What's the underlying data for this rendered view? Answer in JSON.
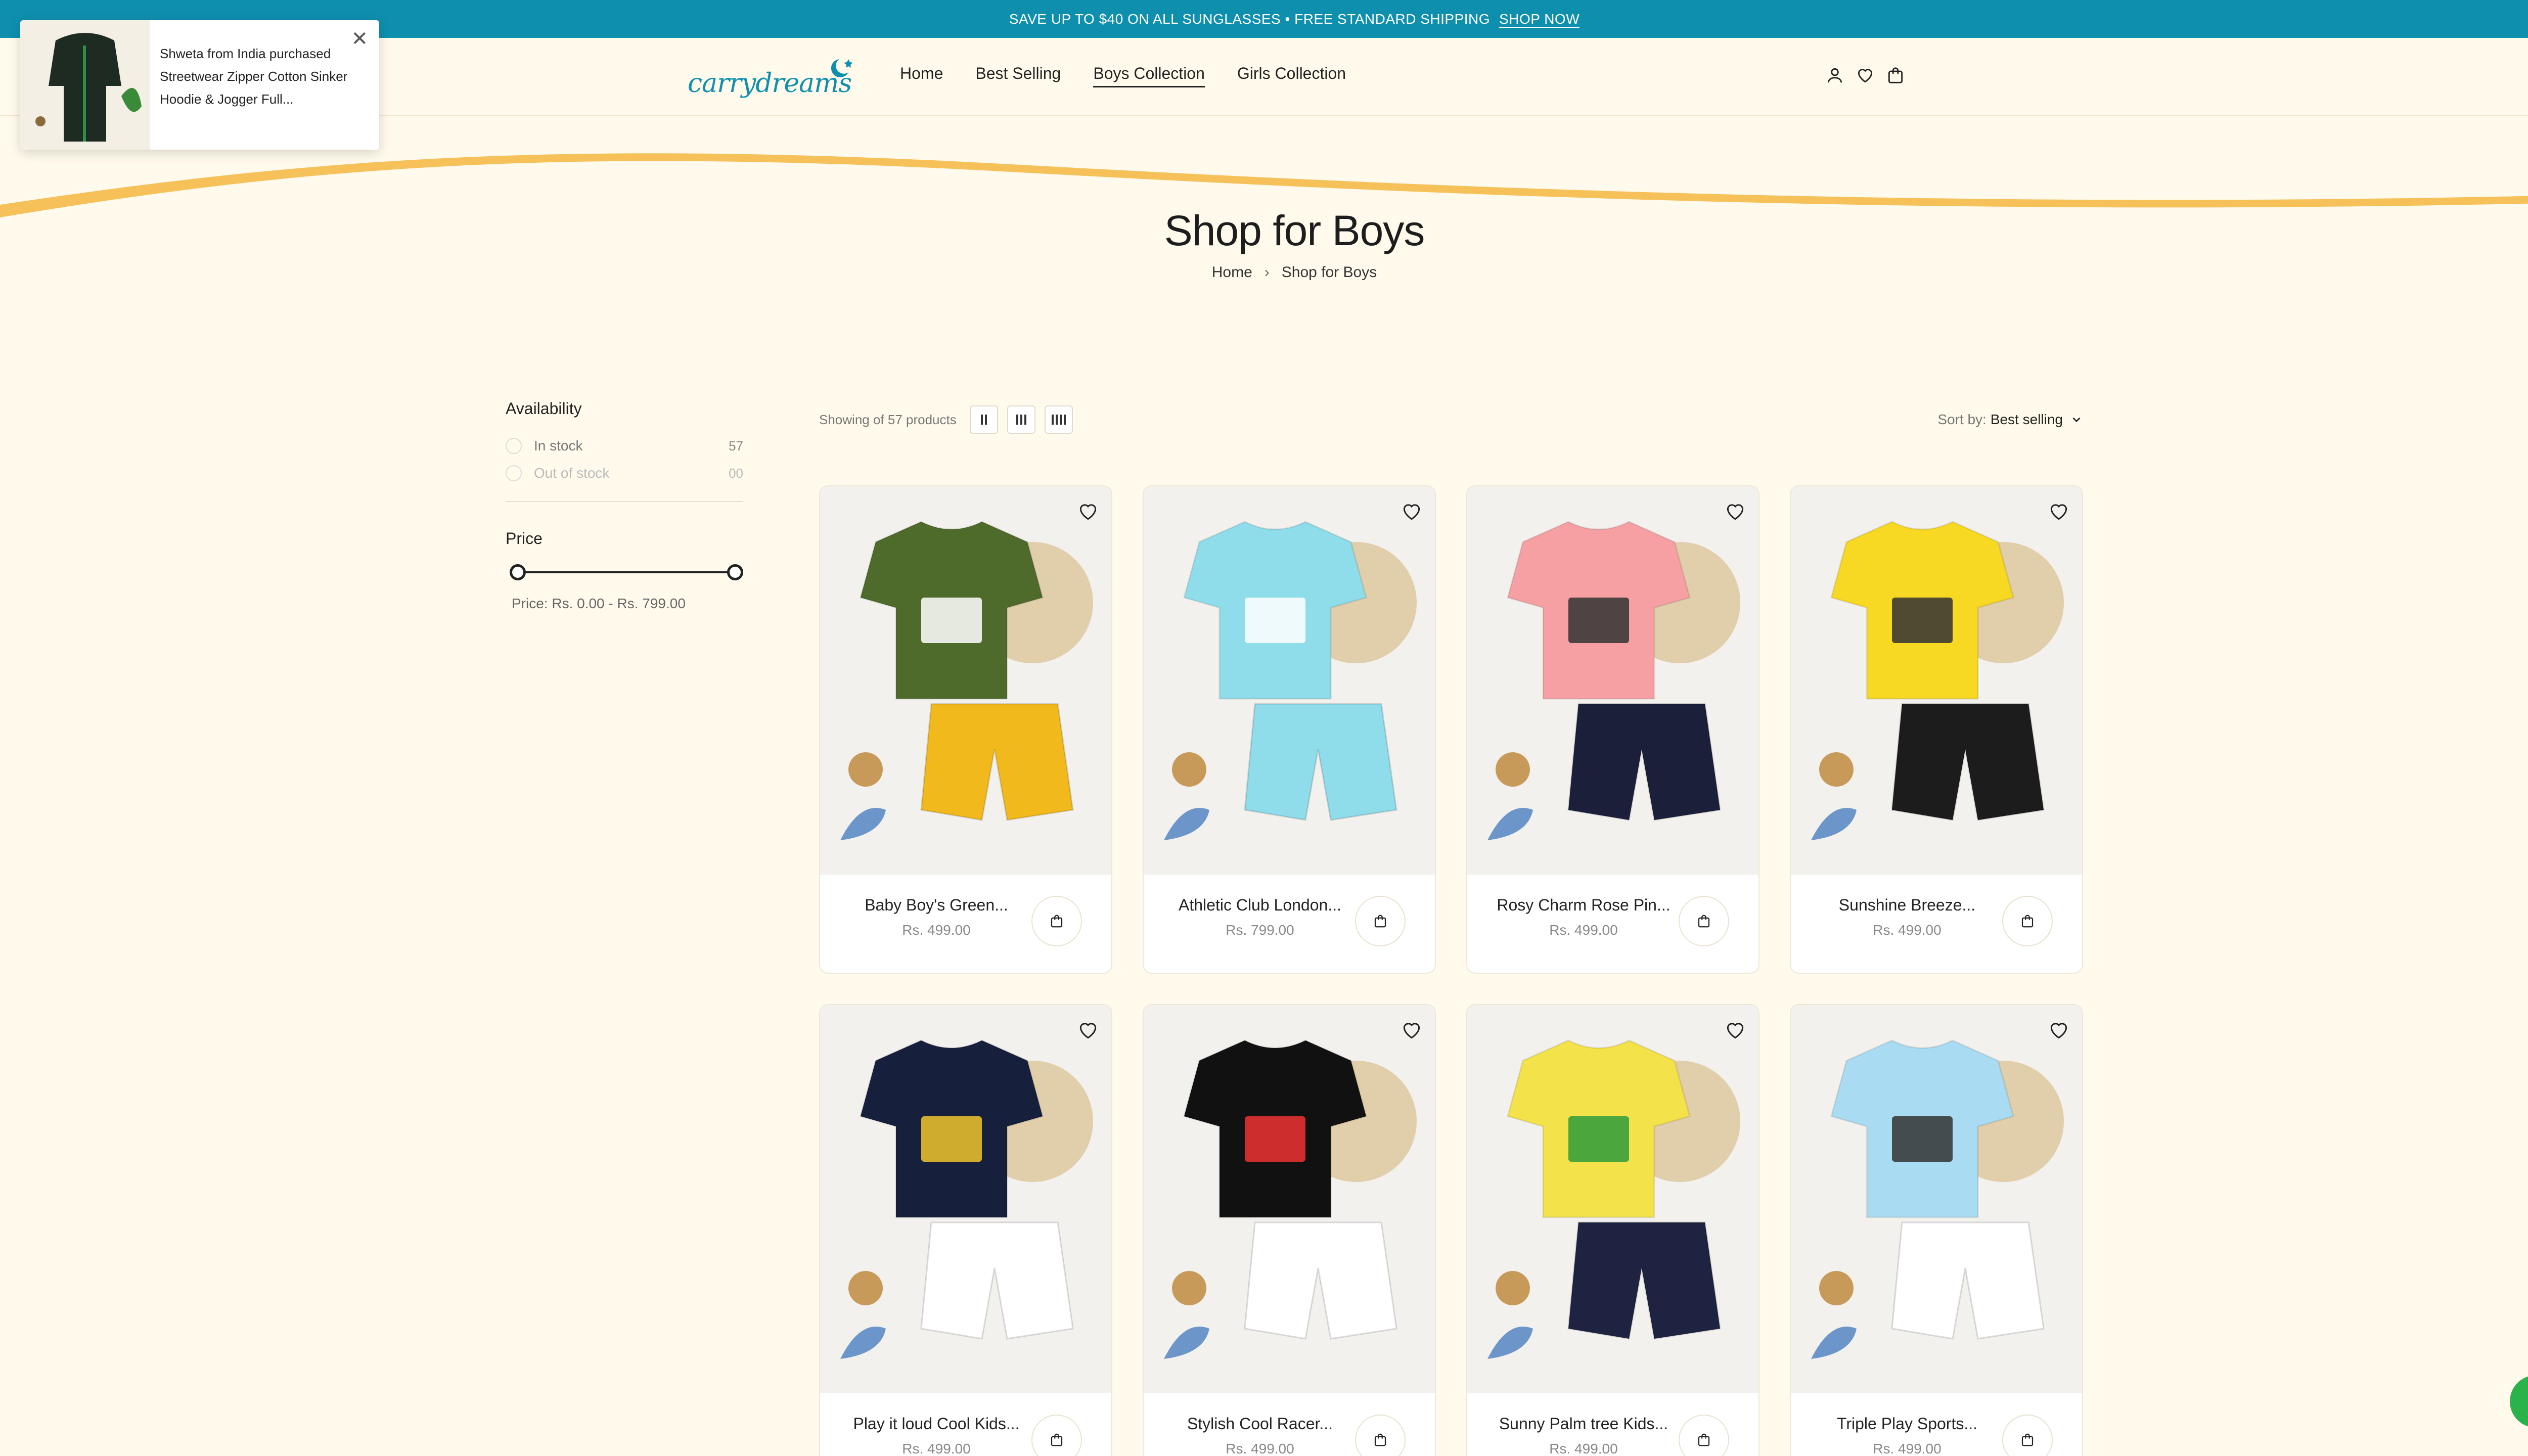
{
  "announcement": {
    "message": "SAVE UP TO $40 ON ALL SUNGLASSES • FREE STANDARD SHIPPING",
    "link_label": "SHOP NOW",
    "close_label": "✕"
  },
  "header": {
    "logo_text": "carrydreams",
    "nav": [
      "Home",
      "Best Selling",
      "Boys Collection",
      "Girls Collection"
    ],
    "active_nav": "Boys Collection",
    "icons": [
      "account-icon",
      "wishlist-icon",
      "cart-icon"
    ]
  },
  "page": {
    "title": "Shop for Boys",
    "breadcrumb": [
      "Home",
      "Shop for Boys"
    ]
  },
  "filters": {
    "availability_title": "Availability",
    "availability": [
      {
        "label": "In stock",
        "count": "57"
      },
      {
        "label": "Out of stock",
        "count": "00"
      }
    ],
    "price_title": "Price",
    "price_range_text": "Price: Rs. 0.00 - Rs. 799.00",
    "price_min": 0,
    "price_max": 799
  },
  "toolbar": {
    "showing": "Showing of 57 products",
    "sort_label": "Sort by:",
    "sort_value": "Best selling"
  },
  "products": [
    {
      "name": "Baby Boy's Green...",
      "price": "Rs. 499.00",
      "shirt": "#4f6b2c",
      "bottom": "#f1b91c",
      "accent": "#fff"
    },
    {
      "name": "Athletic Club London...",
      "price": "Rs. 799.00",
      "shirt": "#8fdcea",
      "bottom": "#8fdcea",
      "accent": "#fff"
    },
    {
      "name": "Rosy Charm Rose Pin...",
      "price": "Rs. 499.00",
      "shirt": "#f6a0a4",
      "bottom": "#1b1f3a",
      "accent": "#333"
    },
    {
      "name": "Sunshine Breeze...",
      "price": "Rs. 499.00",
      "shirt": "#f7d823",
      "bottom": "#1c1c1c",
      "accent": "#333"
    },
    {
      "name": "Play it loud Cool Kids...",
      "price": "Rs. 499.00",
      "shirt": "#16203d",
      "bottom": "#ffffff",
      "accent": "#f0c62b"
    },
    {
      "name": "Stylish Cool Racer...",
      "price": "Rs. 499.00",
      "shirt": "#111111",
      "bottom": "#ffffff",
      "accent": "#e33"
    },
    {
      "name": "Sunny Palm tree Kids...",
      "price": "Rs. 499.00",
      "shirt": "#f4e24a",
      "bottom": "#1d2340",
      "accent": "#2c9b3b"
    },
    {
      "name": "Triple Play Sports...",
      "price": "Rs. 499.00",
      "shirt": "#a9dcf2",
      "bottom": "#ffffff",
      "accent": "#333"
    }
  ],
  "popup": {
    "text": "Shweta from India purchased Streetwear Zipper Cotton Sinker Hoodie & Jogger Full...",
    "close_label": "✕"
  },
  "colors": {
    "topbar": "#0f8fae",
    "background": "#fffaeb",
    "wave": "#f7c15a",
    "whatsapp": "#29b34a"
  }
}
